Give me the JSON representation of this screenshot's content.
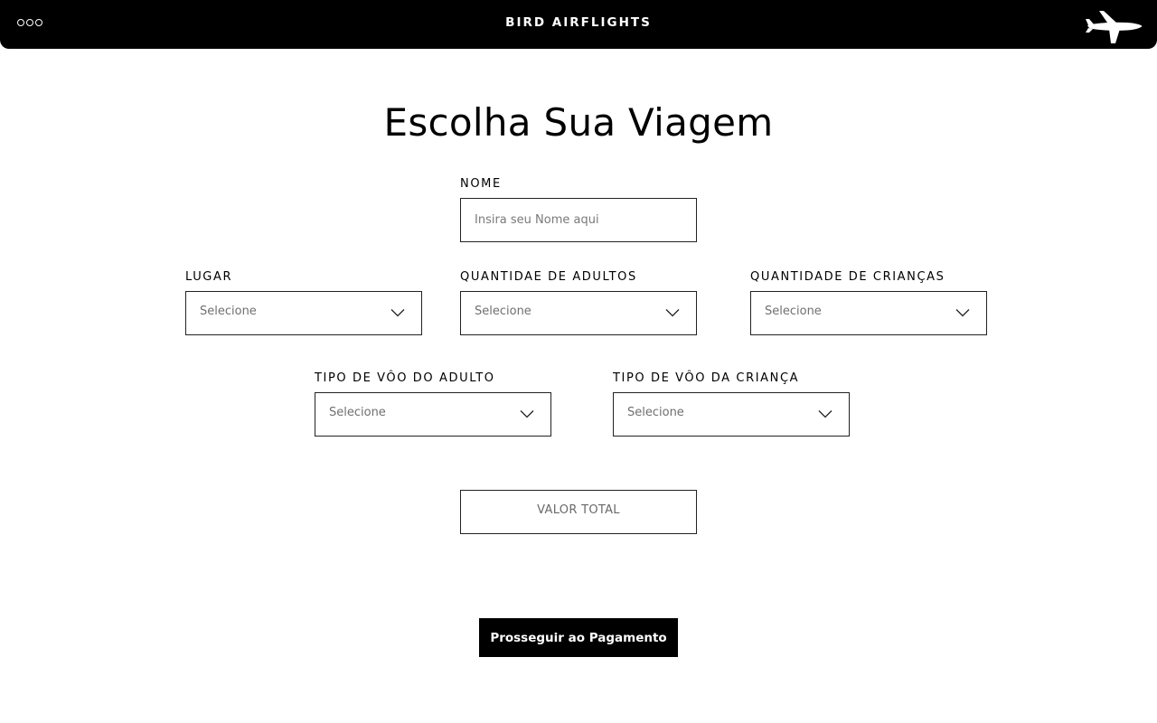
{
  "header": {
    "menu_icon": "three-dots-icon",
    "brand": "BIRD AIRFLIGHTS",
    "logo_icon": "airplane-icon",
    "bg_color": "#000000"
  },
  "main": {
    "title": "Escolha Sua Viagem",
    "name_field": {
      "label": "NOME",
      "value": "",
      "placeholder": "Insira seu Nome aqui"
    },
    "lugar": {
      "label": "LUGAR",
      "value": "Selecione"
    },
    "adultos": {
      "label": "QUANTIDAE DE ADULTOS",
      "value": "Selecione"
    },
    "criancas": {
      "label": "QUANTIDADE DE CRIANÇAS",
      "value": "Selecione"
    },
    "tipo_adulto": {
      "label": "TIPO DE VÔO DO ADULTO",
      "value": "Selecione"
    },
    "tipo_crianca": {
      "label": "TIPO DE VÔO DA CRIANÇA",
      "value": "Selecione"
    },
    "valor_total": "VALOR TOTAL",
    "pay_button": "Prosseguir ao Pagamento"
  }
}
